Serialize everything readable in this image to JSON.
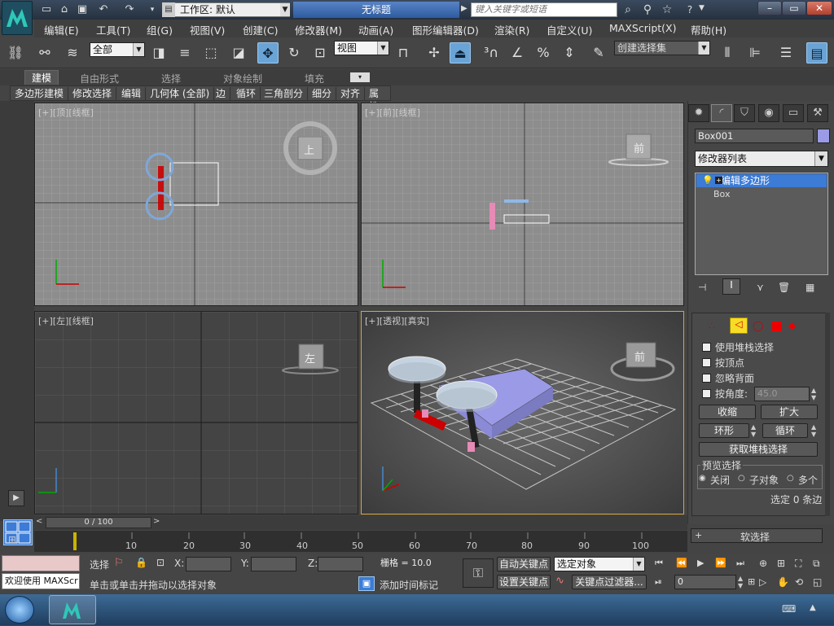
{
  "window": {
    "workspace_label": "工作区: 默认",
    "title": "无标题",
    "search_placeholder": "键入关键字或短语"
  },
  "menu": [
    "编辑(E)",
    "工具(T)",
    "组(G)",
    "视图(V)",
    "创建(C)",
    "修改器(M)",
    "动画(A)",
    "图形编辑器(D)",
    "渲染(R)",
    "自定义(U)",
    "MAXScript(X)",
    "帮助(H)"
  ],
  "toolbar": {
    "filter_select": "全部",
    "ref_coord_select": "视图",
    "named_selection_set": "创建选择集"
  },
  "ribbon": {
    "tabs": [
      "建模",
      "自由形式",
      "选择",
      "对象绘制",
      "填充"
    ],
    "subtabs": [
      "多边形建模",
      "修改选择",
      "编辑",
      "几何体 (全部)",
      "边",
      "循环",
      "三角剖分",
      "细分",
      "对齐",
      "属性"
    ]
  },
  "viewports": {
    "top_label": "[+][顶][线框]",
    "front_label": "[+][前][线框]",
    "left_label": "[+][左][线框]",
    "persp_label": "[+][透视][真实]",
    "viewcube_top": "上",
    "viewcube_front": "前",
    "viewcube_left": "左",
    "viewcube_persp": "前"
  },
  "command_panel": {
    "object_name": "Box001",
    "object_color": "#9a9ae6",
    "modifier_list": "修改器列表",
    "stack": [
      "编辑多边形",
      "Box"
    ],
    "selection": {
      "use_stack": "使用堆栈选择",
      "by_vertex": "按顶点",
      "ignore_backfacing": "忽略背面",
      "by_angle": "按角度:",
      "angle_value": "45.0",
      "shrink": "收缩",
      "grow": "扩大",
      "ring": "环形",
      "loop": "循环",
      "get_stack_selection": "获取堆栈选择",
      "preview_title": "预览选择",
      "preview_off": "关闭",
      "preview_subobj": "子对象",
      "preview_multi": "多个",
      "selected_count": "选定 0 条边",
      "soft_selection": "软选择"
    }
  },
  "timeline": {
    "slider_text": "0 / 100",
    "ticks": [
      "10",
      "20",
      "30",
      "40",
      "50",
      "60",
      "70",
      "80",
      "90",
      "100"
    ]
  },
  "status": {
    "maxscript_welcome": "欢迎使用 MAXScr",
    "selection_lock": "选择",
    "x_label": "X:",
    "y_label": "Y:",
    "z_label": "Z:",
    "grid": "栅格 = 10.0",
    "auto_key": "自动关键点",
    "set_key": "设置关键点",
    "selected_object": "选定对象",
    "key_filters": "关键点过滤器...",
    "prompt": "单击或单击并拖动以选择对象",
    "add_time_tag": "添加时间标记",
    "frame": "0"
  }
}
